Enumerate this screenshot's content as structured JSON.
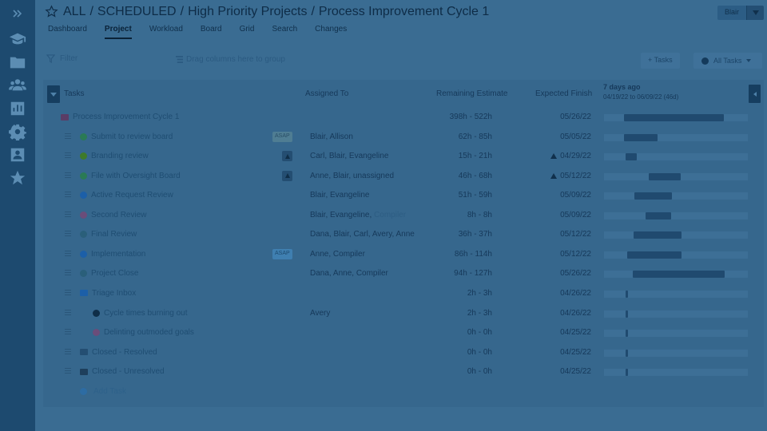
{
  "sidebar": {
    "items": [
      {
        "icon": "expand-icon"
      },
      {
        "icon": "graduation-cap-icon"
      },
      {
        "icon": "folder-icon"
      },
      {
        "icon": "users-icon"
      },
      {
        "icon": "bar-chart-icon"
      },
      {
        "icon": "gear-icon"
      },
      {
        "icon": "contact-card-icon"
      },
      {
        "icon": "star-icon"
      }
    ]
  },
  "header": {
    "breadcrumb": [
      "ALL",
      "SCHEDULED",
      "High Priority Projects",
      "Process Improvement Cycle 1"
    ],
    "separator": "/",
    "user": "Blair"
  },
  "tabs": [
    {
      "label": "Dashboard",
      "active": false
    },
    {
      "label": "Project",
      "active": true
    },
    {
      "label": "Workload",
      "active": false
    },
    {
      "label": "Board",
      "active": false
    },
    {
      "label": "Grid",
      "active": false
    },
    {
      "label": "Search",
      "active": false
    },
    {
      "label": "Changes",
      "active": false
    }
  ],
  "toolbar": {
    "filter_placeholder": "Filter",
    "group_by_placeholder": "Drag columns here to group",
    "add_tasks_label": "+ Tasks",
    "all_tasks_label": "All Tasks"
  },
  "grid": {
    "columns": {
      "tasks": "Tasks",
      "assigned": "Assigned To",
      "estimate": "Remaining Estimate",
      "finish": "Expected Finish"
    },
    "gantt": {
      "title": "7 days ago",
      "range": "04/19/22 to 06/09/22 (46d)"
    },
    "rows": [
      {
        "name": "Process Improvement Cycle 1",
        "assigned": "",
        "assigned_muted": "",
        "estimate": "398h - 522h",
        "finish": "05/26/22",
        "warn": false,
        "badge": "",
        "icon": "project-folder",
        "icon_color": "#5a3d66"
      },
      {
        "name": "Submit to review board",
        "assigned": "Blair, Allison",
        "assigned_muted": "",
        "estimate": "62h - 85h",
        "finish": "05/05/22",
        "warn": false,
        "badge": "ASAP",
        "icon": "task-status",
        "icon_color": "#2a7a55"
      },
      {
        "name": "Branding review",
        "assigned": "Carl, Blair, Evangeline",
        "assigned_muted": "",
        "estimate": "15h - 21h",
        "finish": "04/29/22",
        "warn": true,
        "badge": "warning",
        "icon": "task-status",
        "icon_color": "#3e7a2a"
      },
      {
        "name": "File with Oversight Board",
        "assigned": "Anne, Blair, unassigned",
        "assigned_muted": "",
        "estimate": "46h - 68h",
        "finish": "05/12/22",
        "warn": true,
        "badge": "warning",
        "icon": "task-status",
        "icon_color": "#2a7a55"
      },
      {
        "name": "Active Request Review",
        "assigned": "Blair, Evangeline",
        "assigned_muted": "",
        "estimate": "51h - 59h",
        "finish": "05/09/22",
        "warn": false,
        "badge": "",
        "icon": "task-status",
        "icon_color": "#1c5fa8"
      },
      {
        "name": "Second Review",
        "assigned": "Blair, Evangeline, ",
        "assigned_muted": "Compiler",
        "estimate": "8h - 8h",
        "finish": "05/09/22",
        "warn": false,
        "badge": "",
        "icon": "task-status",
        "icon_color": "#6a4d7a"
      },
      {
        "name": "Final Review",
        "assigned": "Dana, Blair, Carl, Avery, Anne",
        "assigned_muted": "",
        "estimate": "36h - 37h",
        "finish": "05/12/22",
        "warn": false,
        "badge": "",
        "icon": "task-status",
        "icon_color": "#2a5f7a"
      },
      {
        "name": "Implementation",
        "assigned": "Anne, Compiler",
        "assigned_muted": "",
        "estimate": "86h - 114h",
        "finish": "05/12/22",
        "warn": false,
        "badge": "ASAP-blue",
        "icon": "task-status",
        "icon_color": "#1c5fa8"
      },
      {
        "name": "Project Close",
        "assigned": "Dana, Anne, Compiler",
        "assigned_muted": "",
        "estimate": "94h - 127h",
        "finish": "05/26/22",
        "warn": false,
        "badge": "",
        "icon": "task-status",
        "icon_color": "#2a5f7a"
      },
      {
        "name": "Triage Inbox",
        "assigned": "",
        "assigned_muted": "",
        "estimate": "2h - 3h",
        "finish": "04/26/22",
        "warn": false,
        "badge": "",
        "icon": "folder",
        "icon_color": "#1c5fa8"
      },
      {
        "name": "Cycle times burning out",
        "assigned": "Avery",
        "assigned_muted": "",
        "estimate": "2h - 3h",
        "finish": "04/26/22",
        "warn": false,
        "badge": "",
        "icon": "task-status",
        "icon_color": "#0f2e48",
        "indent": 1
      },
      {
        "name": "Delinting outmoded goals",
        "assigned": "",
        "assigned_muted": "",
        "estimate": "0h - 0h",
        "finish": "04/25/22",
        "warn": false,
        "badge": "",
        "icon": "task-status",
        "icon_color": "#6a4d7a",
        "indent": 1
      },
      {
        "name": "Closed - Resolved",
        "assigned": "",
        "assigned_muted": "",
        "estimate": "0h - 0h",
        "finish": "04/25/22",
        "warn": false,
        "badge": "",
        "icon": "folder",
        "icon_color": "#244e72"
      },
      {
        "name": "Closed - Unresolved",
        "assigned": "",
        "assigned_muted": "",
        "estimate": "0h - 0h",
        "finish": "04/25/22",
        "warn": false,
        "badge": "",
        "icon": "folder",
        "icon_color": "#1e3f5c"
      }
    ],
    "add_task_label": "Add Task"
  },
  "colors": {
    "background": "#3a6c92",
    "sidebar": "#1d4a6f",
    "gantt_bar": "#204a6f",
    "gantt_track": "#3d6f96"
  }
}
